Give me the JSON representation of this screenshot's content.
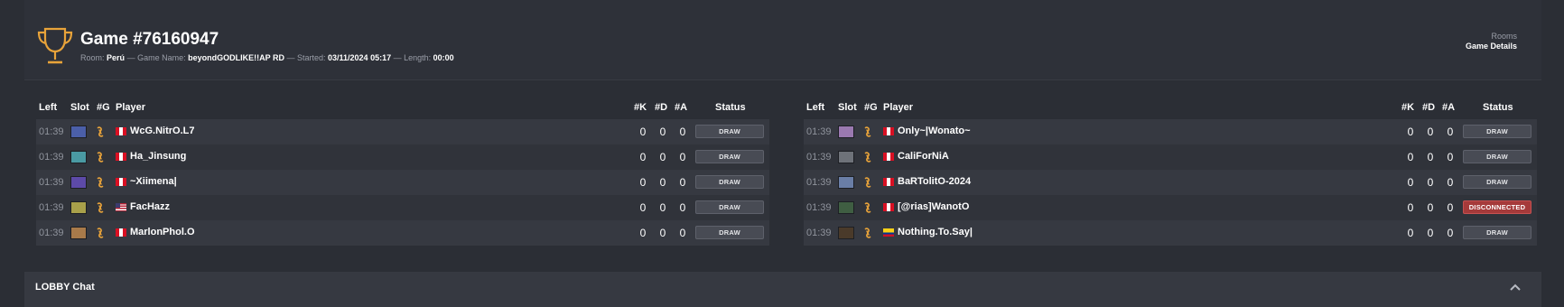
{
  "header": {
    "title": "Game #76160947",
    "room_label": "Room:",
    "room": "Perú",
    "game_name_label": "— Game Name:",
    "game_name": "beyondGODLIKE!!AP RD",
    "started_label": "— Started:",
    "started": "03/11/2024 05:17",
    "length_label": "— Length:",
    "length": "00:00",
    "trophy_icon": "trophy-icon"
  },
  "breadcrumb": {
    "parent": "Rooms",
    "current": "Game Details"
  },
  "columns": {
    "left": "Left",
    "slot": "Slot",
    "g": "#G",
    "player": "Player",
    "k": "#K",
    "d": "#D",
    "a": "#A",
    "status": "Status"
  },
  "teams": [
    {
      "players": [
        {
          "left": "01:39",
          "slot_color": "#4b5fa8",
          "flag": "pe",
          "name": "WcG.NitrO.L7",
          "k": "0",
          "d": "0",
          "a": "0",
          "status": "DRAW",
          "status_type": "draw"
        },
        {
          "left": "01:39",
          "slot_color": "#4a9aa3",
          "flag": "pe",
          "name": "Ha_Jinsung",
          "k": "0",
          "d": "0",
          "a": "0",
          "status": "DRAW",
          "status_type": "draw"
        },
        {
          "left": "01:39",
          "slot_color": "#5d4aa8",
          "flag": "pe",
          "name": "~Xiimena|",
          "k": "0",
          "d": "0",
          "a": "0",
          "status": "DRAW",
          "status_type": "draw"
        },
        {
          "left": "01:39",
          "slot_color": "#a8a04a",
          "flag": "us",
          "name": "FacHazz",
          "k": "0",
          "d": "0",
          "a": "0",
          "status": "DRAW",
          "status_type": "draw"
        },
        {
          "left": "01:39",
          "slot_color": "#a87a4a",
          "flag": "pe",
          "name": "MarlonPhol.O",
          "k": "0",
          "d": "0",
          "a": "0",
          "status": "DRAW",
          "status_type": "draw"
        }
      ]
    },
    {
      "players": [
        {
          "left": "01:39",
          "slot_color": "#9a79b0",
          "flag": "pe",
          "name": "Only~|Wonato~",
          "k": "0",
          "d": "0",
          "a": "0",
          "status": "DRAW",
          "status_type": "draw"
        },
        {
          "left": "01:39",
          "slot_color": "#6e7279",
          "flag": "pe",
          "name": "CaliForNiA",
          "k": "0",
          "d": "0",
          "a": "0",
          "status": "DRAW",
          "status_type": "draw"
        },
        {
          "left": "01:39",
          "slot_color": "#6a7ea6",
          "flag": "pe",
          "name": "BaRTolitO-2024",
          "k": "0",
          "d": "0",
          "a": "0",
          "status": "DRAW",
          "status_type": "draw"
        },
        {
          "left": "01:39",
          "slot_color": "#3f5e42",
          "flag": "pe",
          "name": "[@rias]WanotO",
          "k": "0",
          "d": "0",
          "a": "0",
          "status": "DISCONNECTED",
          "status_type": "disconnected"
        },
        {
          "left": "01:39",
          "slot_color": "#4a3a2a",
          "flag": "co",
          "name": "Nothing.To.Say|",
          "k": "0",
          "d": "0",
          "a": "0",
          "status": "DRAW",
          "status_type": "draw"
        }
      ]
    }
  ],
  "chat": {
    "title": "LOBBY Chat",
    "toggle_icon": "chevron-up-icon"
  },
  "colors": {
    "background": "#2b2e35",
    "accent_orange": "#e8a33a",
    "disconnected": "#a53a3a"
  }
}
